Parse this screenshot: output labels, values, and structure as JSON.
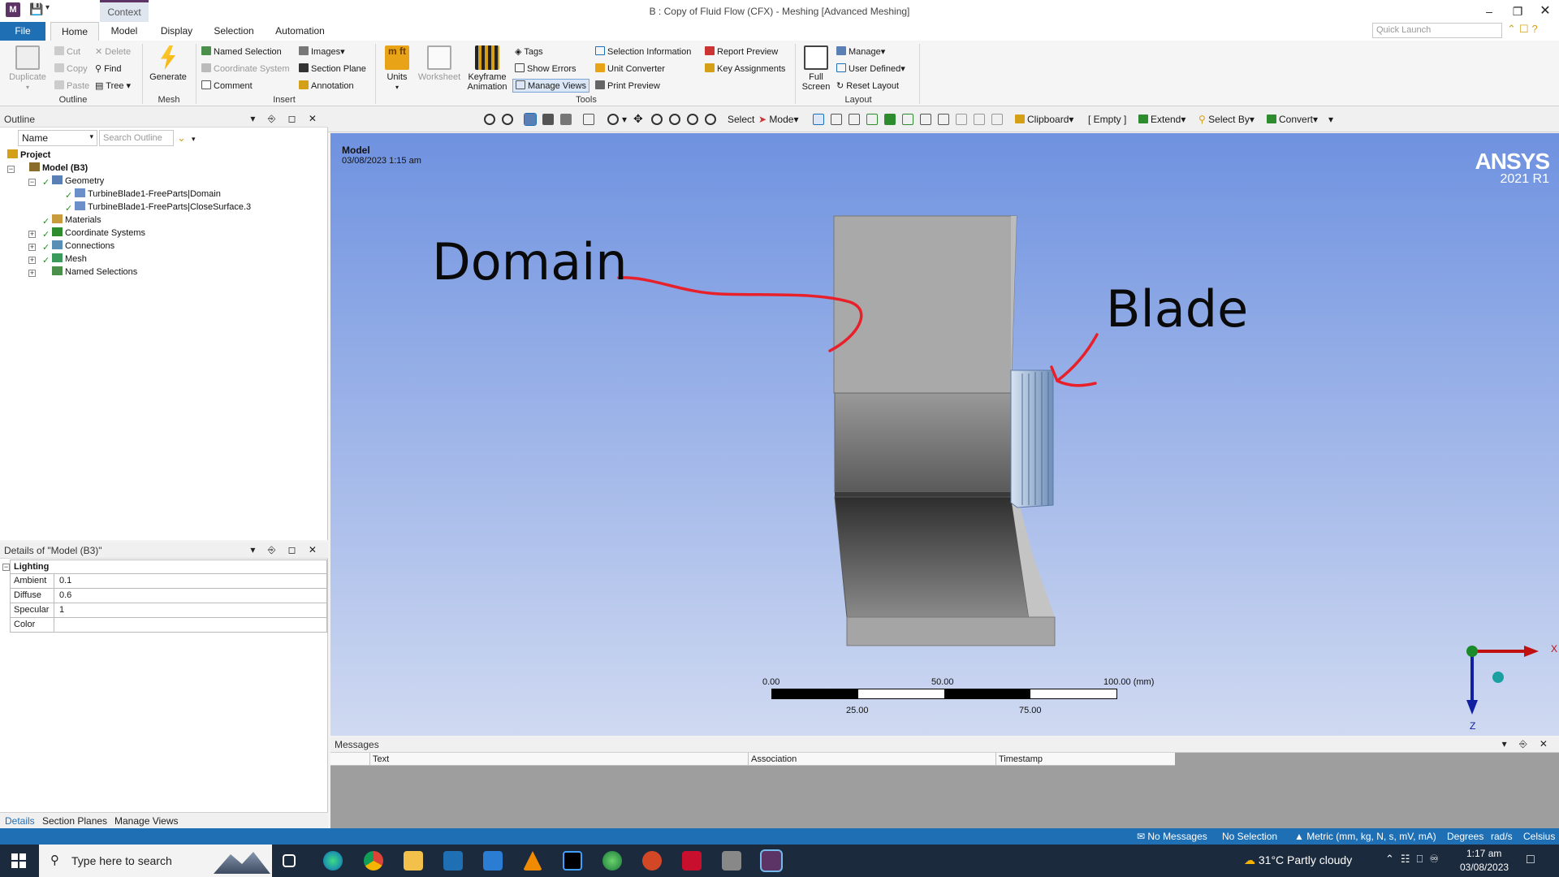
{
  "titlebar": {
    "app_icon": "M",
    "context_tab": "Context",
    "title": "B : Copy of Fluid Flow (CFX) - Meshing [Advanced Meshing]",
    "controls": [
      "minimize-icon",
      "restore-icon",
      "close-icon"
    ]
  },
  "tabs": [
    "File",
    "Home",
    "Model",
    "Display",
    "Selection",
    "Automation"
  ],
  "quick_launch": {
    "placeholder": "Quick Launch"
  },
  "ribbon": {
    "outline_group": {
      "label": "Outline",
      "duplicate": "Duplicate",
      "cut": "Cut",
      "copy": "Copy",
      "paste": "Paste",
      "delete": "Delete",
      "find": "Find",
      "tree": "Tree"
    },
    "mesh_group": {
      "label": "Mesh",
      "generate": "Generate"
    },
    "insert_group": {
      "label": "Insert",
      "named_selection": "Named Selection",
      "coordinate_system": "Coordinate System",
      "comment": "Comment",
      "images": "Images",
      "section_plane": "Section Plane",
      "annotation": "Annotation"
    },
    "tools_group": {
      "label": "Tools",
      "units": "Units",
      "worksheet": "Worksheet",
      "keyframe_line1": "Keyframe",
      "keyframe_line2": "Animation",
      "tags": "Tags",
      "show_errors": "Show Errors",
      "manage_views": "Manage Views",
      "selection_information": "Selection Information",
      "unit_converter": "Unit Converter",
      "print_preview": "Print Preview",
      "report_preview": "Report Preview",
      "key_assignments": "Key Assignments"
    },
    "layout_group": {
      "label": "Layout",
      "full_line1": "Full",
      "full_line2": "Screen",
      "manage": "Manage",
      "user_defined": "User Defined",
      "reset_layout": "Reset Layout"
    }
  },
  "graphics_toolbar": {
    "select": "Select",
    "mode": "Mode",
    "clipboard": "Clipboard",
    "empty": "[ Empty ]",
    "extend": "Extend",
    "select_by": "Select By",
    "convert": "Convert"
  },
  "outline": {
    "title": "Outline",
    "filter": "Name",
    "search_placeholder": "Search Outline",
    "tree": {
      "project": "Project",
      "model": "Model (B3)",
      "geometry": "Geometry",
      "part1": "TurbineBlade1-FreeParts|Domain",
      "part2": "TurbineBlade1-FreeParts|CloseSurface.3",
      "materials": "Materials",
      "coordinate_systems": "Coordinate Systems",
      "connections": "Connections",
      "mesh": "Mesh",
      "named_selections": "Named Selections"
    }
  },
  "details": {
    "title": "Details of \"Model (B3)\"",
    "section": "Lighting",
    "rows": [
      {
        "key": "Ambient",
        "value": "0.1"
      },
      {
        "key": "Diffuse",
        "value": "0.6"
      },
      {
        "key": "Specular",
        "value": "1"
      },
      {
        "key": "Color",
        "value": ""
      }
    ]
  },
  "bottom_tabs": [
    "Details",
    "Section Planes",
    "Manage Views"
  ],
  "viewport": {
    "model_label": "Model",
    "timestamp": "03/08/2023 1:15 am",
    "logo_name": "ANSYS",
    "logo_version": "2021 R1",
    "annotation_domain": "Domain",
    "annotation_blade": "Blade",
    "annotation_color": "#e8202a",
    "scale": {
      "t0": "0.00",
      "t50": "50.00",
      "t100": "100.00 (mm)",
      "t25": "25.00",
      "t75": "75.00"
    },
    "triad": {
      "x": "X",
      "z": "Z"
    }
  },
  "messages": {
    "title": "Messages",
    "columns": [
      "Text",
      "Association",
      "Timestamp"
    ]
  },
  "statusbar": {
    "messages": "No Messages",
    "selection": "No Selection",
    "units": "Metric (mm, kg, N, s, mV, mA)",
    "angle": "Degrees",
    "rate": "rad/s",
    "temp": "Celsius"
  },
  "taskbar": {
    "search_placeholder": "Type here to search",
    "apps": [
      "task-view-icon",
      "edge-icon",
      "chrome-icon",
      "file-explorer-icon",
      "store-icon",
      "mail-icon",
      "vlc-icon",
      "workbench-icon",
      "maps-icon",
      "powerpoint-icon",
      "solidworks-icon",
      "wb-icon",
      "meshing-icon"
    ],
    "weather": "31°C  Partly cloudy",
    "time": "1:17 am",
    "date": "03/08/2023"
  },
  "colors": {
    "accent": "#1f6fb5",
    "viewport_top": "#6f92e0",
    "viewport_bottom": "#cfd9f1"
  }
}
